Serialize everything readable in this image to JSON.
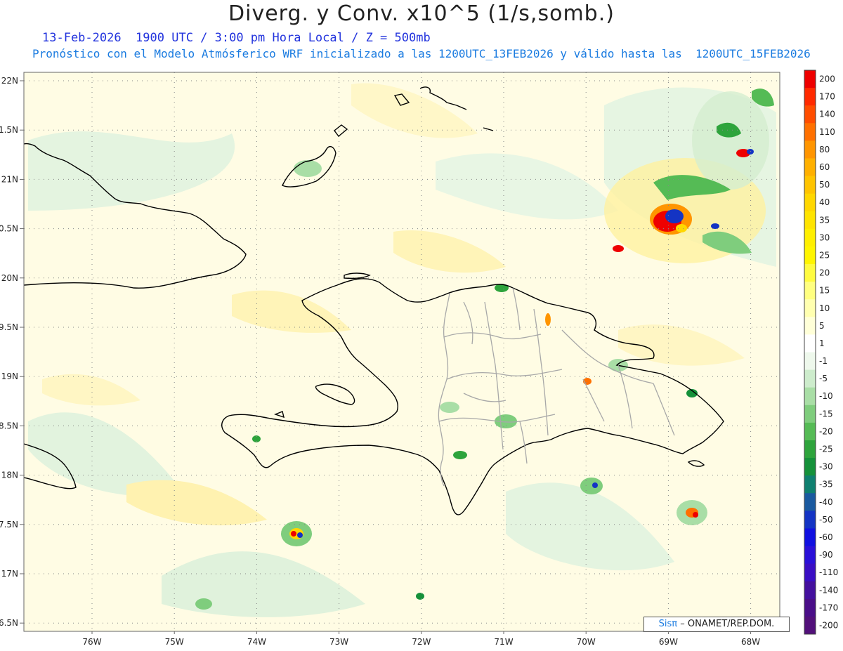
{
  "title": "Diverg. y Conv. x10^5 (1/s,somb.)",
  "subtitle_line1": "13-Feb-2026  1900 UTC / 3:00 pm Hora Local / Z = 500mb",
  "subtitle_line2": "Pronóstico con el Modelo Atmósferico WRF inicializado a las 1200UTC_13FEB2026 y válido hasta las  1200UTC_15FEB2026",
  "credit": {
    "logo": "Sisπ",
    "text": "– ONAMET/REP.DOM."
  },
  "map": {
    "lon_labels": [
      "76W",
      "75W",
      "74W",
      "73W",
      "72W",
      "71W",
      "70W",
      "69W",
      "68W"
    ],
    "lat_labels": [
      "22N",
      "1.5N",
      "21N",
      "0.5N",
      "20N",
      "9.5N",
      "19N",
      "8.5N",
      "18N",
      "7.5N",
      "17N",
      "6.5N"
    ],
    "lon_range": [
      -76.6,
      -67.6
    ],
    "lat_range": [
      16.5,
      22.0
    ]
  },
  "colorbar": {
    "labels": [
      "200",
      "170",
      "140",
      "110",
      "80",
      "60",
      "50",
      "40",
      "35",
      "30",
      "25",
      "20",
      "15",
      "10",
      "5",
      "1",
      "-1",
      "-5",
      "-10",
      "-15",
      "-20",
      "-25",
      "-30",
      "-35",
      "-40",
      "-50",
      "-60",
      "-90",
      "-110",
      "-140",
      "-170",
      "-200"
    ],
    "colors": [
      "#ee0000",
      "#ff2a00",
      "#ff4d00",
      "#ff7000",
      "#ff9500",
      "#ffb000",
      "#ffc400",
      "#ffd700",
      "#ffe400",
      "#ffef00",
      "#fff500",
      "#fffb40",
      "#ffff80",
      "#ffffb0",
      "#ffffd8",
      "#ffffff",
      "#eef8ec",
      "#cdeccc",
      "#a9dea6",
      "#7fcd7d",
      "#55bb55",
      "#2ea43c",
      "#15913a",
      "#0f8070",
      "#1a5aa0",
      "#1434c4",
      "#1010e0",
      "#2a10d8",
      "#3a0ec4",
      "#44109e",
      "#4a0e88",
      "#52107a"
    ]
  },
  "colors": {
    "coast": "#000000",
    "borders": "#a8a8a8",
    "grid": "#888888",
    "divergence": "#fff6b0",
    "convergence": "#c8ecc4"
  }
}
